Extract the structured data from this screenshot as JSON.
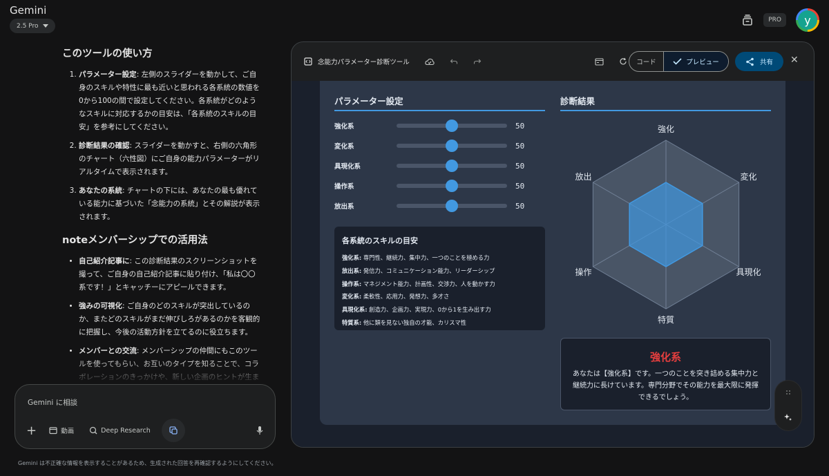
{
  "app": {
    "title": "Gemini",
    "model": "2.5 Pro",
    "pro_badge": "PRO",
    "avatar_letter": "y"
  },
  "chat": {
    "howto_heading": "このツールの使い方",
    "steps": [
      {
        "bold": "パラメーター設定",
        "text": ": 左側のスライダーを動かして、ご自身のスキルや特性に最も近いと思われる各系統の数値を0から100の間で設定してください。各系統がどのようなスキルに対応するかの目安は、「各系統のスキルの目安」を参考にしてください。"
      },
      {
        "bold": "診断結果の確認",
        "text": ": スライダーを動かすと、右側の六角形のチャート（六性図）にご自身の能力パラメーターがリアルタイムで表示されます。"
      },
      {
        "bold": "あなたの系統",
        "text": ": チャートの下には、あなたの最も優れている能力に基づいた「念能力の系統」とその解説が表示されます。"
      }
    ],
    "note_heading": "noteメンバーシップでの活用法",
    "uses": [
      {
        "bold": "自己紹介記事に",
        "text": ": この診断結果のスクリーンショットを撮って、ご自身の自己紹介記事に貼り付け、「私は〇〇系です！」とキャッチーにアピールできます。"
      },
      {
        "bold": "強みの可視化",
        "text": ": ご自身のどのスキルが突出しているのか、またどのスキルがまだ伸びしろがあるのかを客観的に把握し、今後の活動方針を立てるのに役立ちます。"
      },
      {
        "bold": "メンバーとの交流",
        "text": ": メンバーシップの仲間にもこのツールを使ってもらい、お互いのタイプを知ることで、コラボレーションのきっかけや、新しい企画のヒントが生まれるかもしれません。"
      }
    ]
  },
  "composer": {
    "placeholder": "Gemini に相談",
    "video_label": "動画",
    "research_label": "Deep Research",
    "disclaimer": "Gemini は不正確な情報を表示することがあるため、生成された回答を再確認するようにしてください。"
  },
  "canvas": {
    "title": "念能力パラメーター診断ツール",
    "code_tab": "コード",
    "preview_tab": "プレビュー",
    "share_label": "共有"
  },
  "tool": {
    "params_title": "パラメーター設定",
    "result_title": "診断結果",
    "sliders": [
      {
        "label": "強化系",
        "value": 50
      },
      {
        "label": "変化系",
        "value": 50
      },
      {
        "label": "具現化系",
        "value": 50
      },
      {
        "label": "操作系",
        "value": 50
      },
      {
        "label": "放出系",
        "value": 50
      }
    ],
    "guide_title": "各系統のスキルの目安",
    "guide": [
      {
        "name": "強化系:",
        "desc": " 専門性、継続力、集中力、一つのことを極める力"
      },
      {
        "name": "放出系:",
        "desc": " 発信力、コミュニケーション能力、リーダーシップ"
      },
      {
        "name": "操作系:",
        "desc": " マネジメント能力、計画性、交渉力、人を動かす力"
      },
      {
        "name": "変化系:",
        "desc": " 柔軟性、応用力、発想力、多才さ"
      },
      {
        "name": "具現化系:",
        "desc": " 創造力、企画力、実現力、0から1を生み出す力"
      },
      {
        "name": "特質系:",
        "desc": " 他に類を見ない独自の才能、カリスマ性"
      }
    ],
    "radar_labels": [
      "強化",
      "変化",
      "具現化",
      "特質",
      "操作",
      "放出"
    ],
    "radar_values": [
      50,
      50,
      50,
      50,
      50,
      50
    ],
    "radar_max": 100,
    "result_name": "強化系",
    "result_desc": "あなたは【強化系】です。一つのことを突き詰める集中力と継続力に長けています。専門分野でその能力を最大限に発揮できるでしょう。",
    "accent": "#4299e1",
    "result_color": "#e53e3e"
  }
}
